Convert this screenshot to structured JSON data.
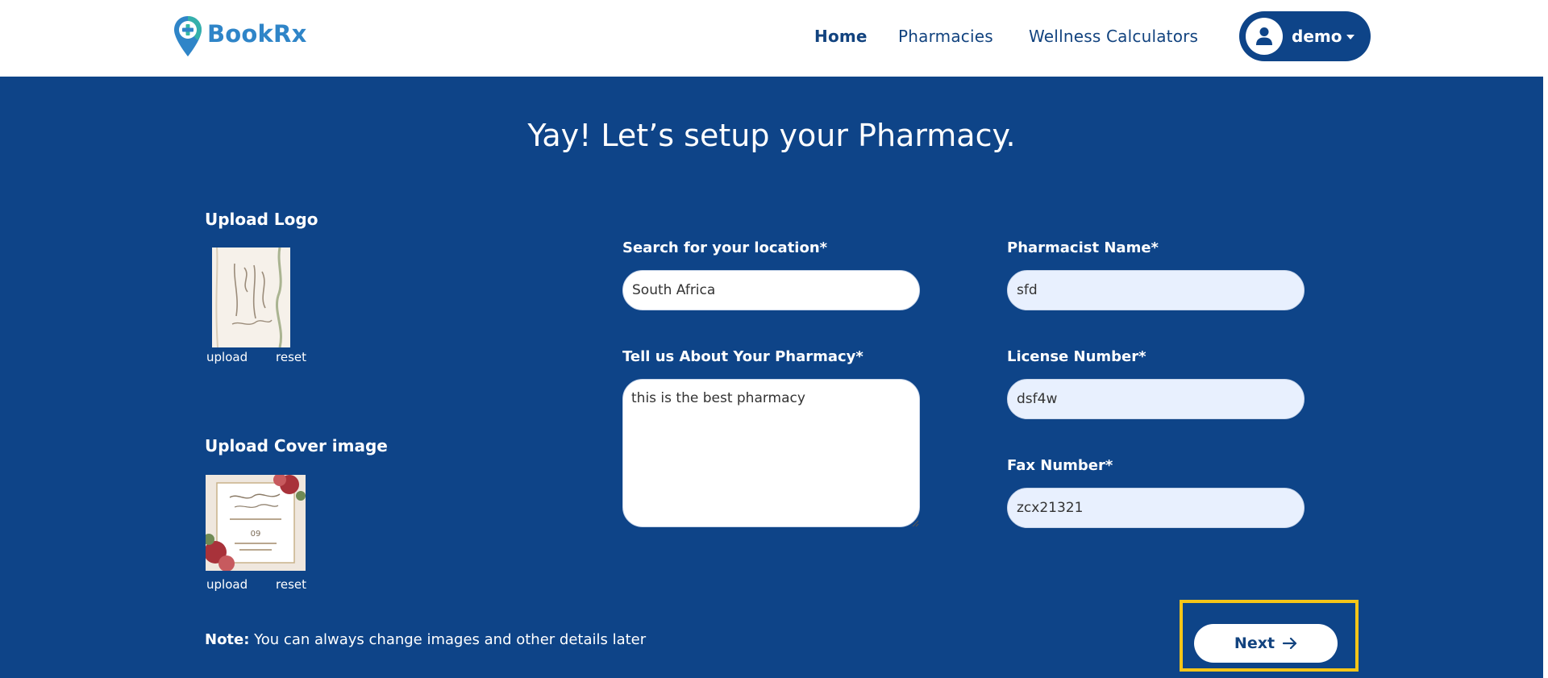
{
  "brand": {
    "name": "BookRx",
    "logo_icon": "map-pin-plus-icon",
    "accent": "#2f85c8",
    "teal": "#35b7a6"
  },
  "nav": {
    "items": [
      {
        "label": "Home"
      },
      {
        "label": "Pharmacies"
      },
      {
        "label": "Wellness Calculators"
      }
    ],
    "user": {
      "name": "demo",
      "icon": "user-icon"
    }
  },
  "page": {
    "title": "Yay! Let’s setup your Pharmacy."
  },
  "logo_upload": {
    "title": "Upload Logo",
    "upload_label": "upload",
    "reset_label": "reset"
  },
  "cover_upload": {
    "title": "Upload Cover image",
    "upload_label": "upload",
    "reset_label": "reset"
  },
  "form": {
    "location": {
      "label": "Search for your location*",
      "value": "South Africa"
    },
    "about": {
      "label": "Tell us About Your Pharmacy*",
      "value": "this is the best pharmacy"
    },
    "pharmacist": {
      "label": "Pharmacist Name*",
      "value": "sfd"
    },
    "license": {
      "label": "License Number*",
      "value": "dsf4w"
    },
    "fax": {
      "label": "Fax Number*",
      "value": "zcx21321"
    }
  },
  "note": {
    "prefix": "Note:",
    "text": " You can always change images and other details later"
  },
  "next_button": {
    "label": "Next",
    "icon": "arrow-right-icon"
  },
  "colors": {
    "background": "#0e4488",
    "header": "#ffffff",
    "highlight": "#f5c518",
    "navy_text": "#12437f"
  }
}
